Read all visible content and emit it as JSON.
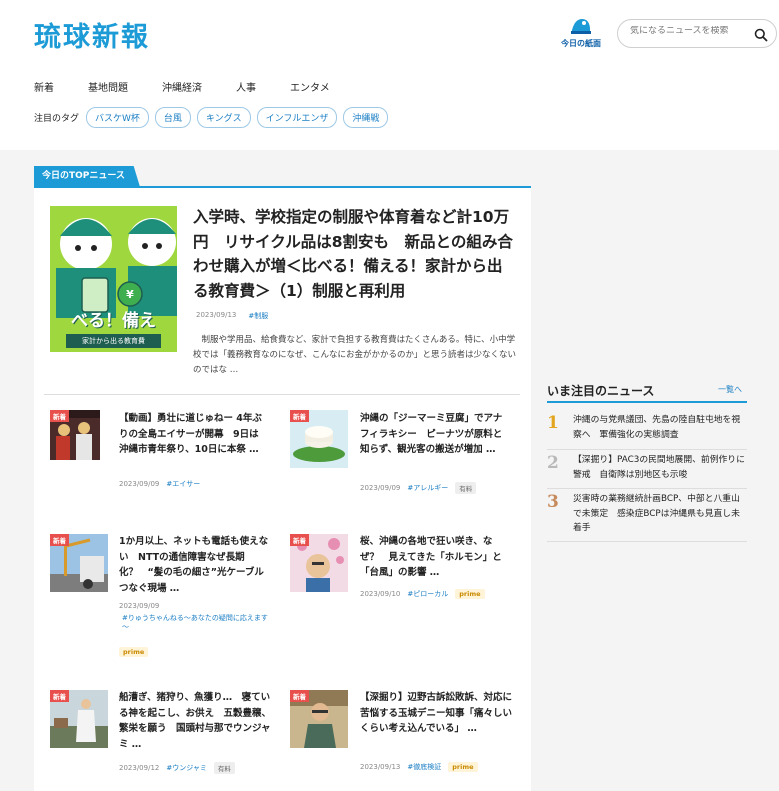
{
  "header": {
    "logo": "琉球新報",
    "paper_label": "今日の紙面",
    "search_placeholder": "気になるニュースを検索"
  },
  "nav": {
    "items": [
      "新着",
      "基地問題",
      "沖縄経済",
      "人事",
      "エンタメ"
    ]
  },
  "tags": {
    "label": "注目のタグ",
    "items": [
      "バスケW杯",
      "台風",
      "キングス",
      "インフルエンザ",
      "沖縄戦"
    ]
  },
  "top_news": {
    "label": "今日のTOPニュース",
    "lead": {
      "title": "入学時、学校指定の制服や体育着など計10万円　リサイクル品は8割安も　新品との組み合わせ購入が増＜比べる！備える！家計から出る教育費＞（1）制服と再利用",
      "date": "2023/09/13",
      "tag": "#制服",
      "description": "制服や学用品、給食費など、家計で負担する教育費はたくさんある。特に、小中学校では「義務教育なのになぜ、こんなにお金がかかるのか」と思う読者は少なくないのではな …",
      "image_text_1": "べる！備え",
      "image_text_2": "家計から出る教育費"
    },
    "articles": [
      {
        "badge": "新着",
        "title": "【動画】勇壮に道じゅねー 4年ぶりの全島エイサーが開幕　9日は沖縄市青年祭り、10日に本祭 …",
        "date": "2023/09/09",
        "tag": "#エイサー"
      },
      {
        "badge": "新着",
        "title": "沖縄の「ジーマーミ豆腐」でアナフィラキシー　ピーナツが原料と知らず、観光客の搬送が増加 …",
        "date": "2023/09/09",
        "tag": "#アレルギー",
        "label": "有料"
      },
      {
        "badge": "新着",
        "title": "1か月以上、ネットも電話も使えない　NTTの通信障害なぜ長期化？　“髪の毛の細さ”光ケーブルつなぐ現場 …",
        "date": "2023/09/09",
        "tag": "#りゅうちゃんねる～あなたの疑問に応えます～",
        "label": "prime"
      },
      {
        "badge": "新着",
        "title": "桜、沖縄の各地で狂い咲き、なぜ？　見えてきた「ホルモン」と「台風」の影響 …",
        "date": "2023/09/10",
        "tag": "#ピローカル",
        "label": "prime"
      },
      {
        "badge": "新着",
        "title": "船漕ぎ、猪狩り、魚獲り…　寝ている神を起こし、お供え　五穀豊穣、繁栄を願う　国頭村与那でウンジャミ …",
        "date": "2023/09/12",
        "tag": "#ウンジャミ",
        "label": "有料"
      },
      {
        "badge": "新着",
        "title": "【深掘り】辺野古訴訟敗訴、対応に苦悩する玉城デニー知事「痛々しいくらい考え込んでいる」 …",
        "date": "2023/09/13",
        "tag": "#徹底検証",
        "label": "prime"
      }
    ]
  },
  "sidebar": {
    "title": "いま注目のニュース",
    "more": "一覧へ",
    "items": [
      {
        "rank": "1",
        "text": "沖縄の与党県議団、先島の陸自駐屯地を視察へ　軍備強化の実態調査"
      },
      {
        "rank": "2",
        "text": "【深掘り】PAC3の民間地展開、前例作りに警戒　自衛隊は別地区も示唆"
      },
      {
        "rank": "3",
        "text": "災害時の業務継続計画BCP、中部と八重山で未策定　感染症BCPは沖縄県も見直し未着手"
      }
    ]
  },
  "colors": {
    "accent": "#1c9bd6",
    "badge": "#e8504d",
    "rank": "#e39c1f"
  }
}
